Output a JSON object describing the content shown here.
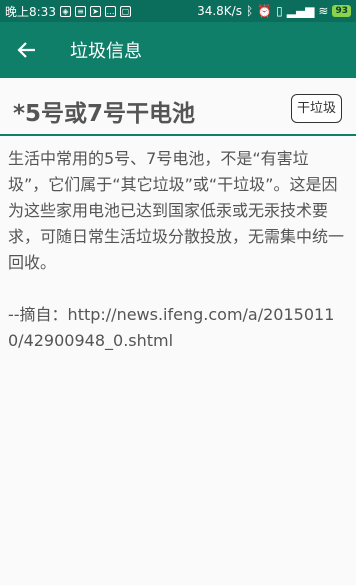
{
  "status_bar": {
    "time": "晚上8:33",
    "network_speed": "34.8K/s",
    "battery": "93"
  },
  "app_bar": {
    "title": "垃圾信息",
    "back_icon": "arrow-left-icon"
  },
  "item": {
    "title": "*5号或7号干电池",
    "category": "干垃圾"
  },
  "content": {
    "description": "生活中常用的5号、7号电池，不是“有害垃圾”，它们属于“其它垃圾”或“干垃圾”。这是因为这些家用电池已达到国家低汞或无汞技术要求，可随日常生活垃圾分散投放，无需集中统一回收。",
    "source": "--摘自：http://news.ifeng.com/a/20150110/42900948_0.shtml"
  },
  "colors": {
    "status_bar_bg": "#0b6e5c",
    "app_bar_bg": "#0f7f69",
    "accent_line": "#0f7f69"
  }
}
